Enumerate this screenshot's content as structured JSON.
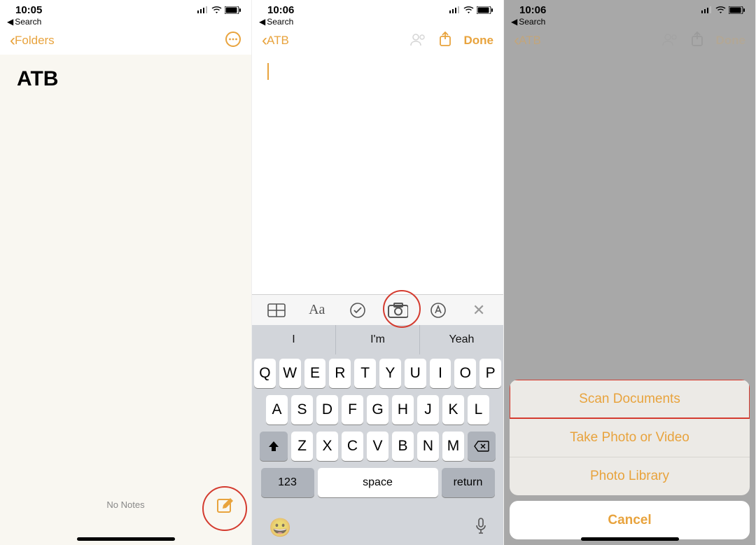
{
  "accent": "#E8A33D",
  "status": {
    "time1": "10:05",
    "time2": "10:06",
    "time3": "10:06"
  },
  "back_search": "Search",
  "phone1": {
    "back": "Folders",
    "title": "ATB",
    "empty": "No Notes"
  },
  "phone2": {
    "back": "ATB",
    "done": "Done",
    "suggestions": [
      "I",
      "I'm",
      "Yeah"
    ],
    "rows": [
      [
        "Q",
        "W",
        "E",
        "R",
        "T",
        "Y",
        "U",
        "I",
        "O",
        "P"
      ],
      [
        "A",
        "S",
        "D",
        "F",
        "G",
        "H",
        "J",
        "K",
        "L"
      ],
      [
        "Z",
        "X",
        "C",
        "V",
        "B",
        "N",
        "M"
      ]
    ],
    "num": "123",
    "space": "space",
    "return": "return"
  },
  "phone3": {
    "back": "ATB",
    "done": "Done",
    "sheet": [
      "Scan Documents",
      "Take Photo or Video",
      "Photo Library"
    ],
    "cancel": "Cancel"
  }
}
